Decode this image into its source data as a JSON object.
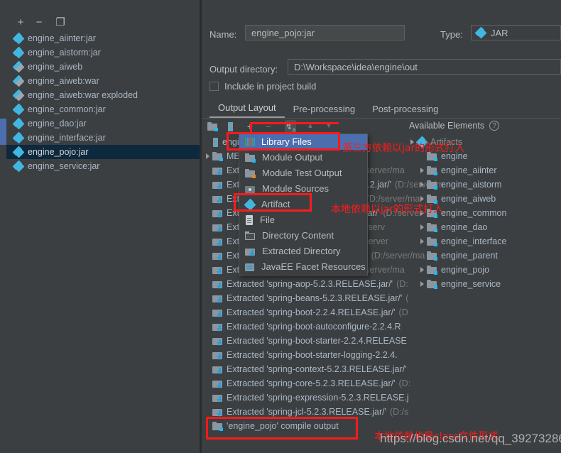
{
  "left_panel": {
    "toolbar": [
      {
        "name": "add",
        "glyph": "+"
      },
      {
        "name": "remove",
        "glyph": "−"
      },
      {
        "name": "copy",
        "glyph": "❐"
      }
    ],
    "items": [
      {
        "label": "engine_aiinter:jar",
        "icon": "jar-icon",
        "selected": false
      },
      {
        "label": "engine_aistorm:jar",
        "icon": "jar-icon",
        "selected": false
      },
      {
        "label": "engine_aiweb",
        "icon": "war-icon",
        "selected": false
      },
      {
        "label": "engine_aiweb:war",
        "icon": "war-icon",
        "selected": false
      },
      {
        "label": "engine_aiweb:war exploded",
        "icon": "war-icon",
        "selected": false
      },
      {
        "label": "engine_common:jar",
        "icon": "jar-icon",
        "selected": false
      },
      {
        "label": "engine_dao:jar",
        "icon": "jar-icon",
        "selected": false
      },
      {
        "label": "engine_interface:jar",
        "icon": "jar-icon",
        "selected": false
      },
      {
        "label": "engine_pojo:jar",
        "icon": "jar-icon",
        "selected": true
      },
      {
        "label": "engine_service:jar",
        "icon": "jar-icon",
        "selected": false
      }
    ]
  },
  "form": {
    "name_label": "Name:",
    "name_value": "engine_pojo:jar",
    "type_label": "Type:",
    "type_value": "JAR",
    "output_dir_label": "Output directory:",
    "output_dir_value": "D:\\Workspace\\idea\\engine\\out",
    "include_checkbox_label": "Include in project build",
    "include_checked": false
  },
  "tabs": [
    {
      "label": "Output Layout",
      "active": true
    },
    {
      "label": "Pre-processing",
      "active": false
    },
    {
      "label": "Post-processing",
      "active": false
    }
  ],
  "layout_toolbar": [
    {
      "name": "create-directory",
      "glyph": "▤"
    },
    {
      "name": "create-archive",
      "glyph": "‖"
    },
    {
      "name": "add-element",
      "glyph": "+"
    },
    {
      "name": "remove-element",
      "glyph": "−"
    },
    {
      "name": "sort-az",
      "glyph": "↧"
    },
    {
      "name": "move-up",
      "glyph": "▲"
    },
    {
      "name": "move-down",
      "glyph": "▼"
    }
  ],
  "available_elements": {
    "title": "Available Elements",
    "help_glyph": "?",
    "root": "Artifacts",
    "items": [
      {
        "label": "engine",
        "expandable": false
      },
      {
        "label": "engine_aiinter",
        "expandable": true
      },
      {
        "label": "engine_aistorm",
        "expandable": true
      },
      {
        "label": "engine_aiweb",
        "expandable": true
      },
      {
        "label": "engine_common",
        "expandable": true
      },
      {
        "label": "engine_dao",
        "expandable": true
      },
      {
        "label": "engine_interface",
        "expandable": true
      },
      {
        "label": "engine_parent",
        "expandable": false
      },
      {
        "label": "engine_pojo",
        "expandable": true
      },
      {
        "label": "engine_service",
        "expandable": true
      }
    ]
  },
  "output_tree": {
    "rows": [
      {
        "label": "engine_pojo.jar",
        "icon": "archive-icon",
        "hint": "",
        "arrow": false,
        "indent": 0
      },
      {
        "label": "META-INF",
        "icon": "folder-icon",
        "hint": "",
        "arrow": true,
        "indent": 0
      },
      {
        "label": "Extracted 'classmate-1.3.5.jar/'",
        "icon": "extracted-icon",
        "hint": "(D:/server/ma",
        "arrow": true,
        "indent": 0
      },
      {
        "label": "Extracted 'jackson-annotations-2.10.2.jar/'",
        "icon": "extracted-icon",
        "hint": "(D:/server/m",
        "arrow": true,
        "indent": 0
      },
      {
        "label": "Extracted 'jackson-core-2.10.2.jar/'",
        "icon": "extracted-icon",
        "hint": "(D:/server/ma",
        "arrow": true,
        "indent": 0
      },
      {
        "label": "Extracted 'jackson-databind-2.10.2.jar/'",
        "icon": "extracted-icon",
        "hint": "(D:/server",
        "arrow": true,
        "indent": 0
      },
      {
        "label": "Extracted 'jul-to-slf4j-1.7.30.jar/'",
        "icon": "extracted-icon",
        "hint": "(D:/serv",
        "arrow": true,
        "indent": 0
      },
      {
        "label": "Extracted 'log4j-api-2.12.1.jar/'",
        "icon": "extracted-icon",
        "hint": "(D:/server",
        "arrow": true,
        "indent": 0
      },
      {
        "label": "Extracted 'logback-classic-1.2.3.jar/'",
        "icon": "extracted-icon",
        "hint": "(D:/server/ma",
        "arrow": false,
        "indent": 0
      },
      {
        "label": "Extracted 'snakeyaml-1.25.jar/'",
        "icon": "extracted-icon",
        "hint": "(D:/server/ma",
        "arrow": true,
        "indent": 0
      },
      {
        "label": "Extracted 'spring-aop-5.2.3.RELEASE.jar/'",
        "icon": "extracted-icon",
        "hint": "(D:",
        "arrow": true,
        "indent": 0
      },
      {
        "label": "Extracted 'spring-beans-5.2.3.RELEASE.jar/'",
        "icon": "extracted-icon",
        "hint": "(",
        "arrow": false,
        "indent": 0
      },
      {
        "label": "Extracted 'spring-boot-2.2.4.RELEASE.jar/'",
        "icon": "extracted-icon",
        "hint": "(D",
        "arrow": false,
        "indent": 0
      },
      {
        "label": "Extracted 'spring-boot-autoconfigure-2.2.4.R",
        "icon": "extracted-icon",
        "hint": "",
        "arrow": false,
        "indent": 0
      },
      {
        "label": "Extracted 'spring-boot-starter-2.2.4.RELEASE",
        "icon": "extracted-icon",
        "hint": "",
        "arrow": false,
        "indent": 0
      },
      {
        "label": "Extracted 'spring-boot-starter-logging-2.2.4.",
        "icon": "extracted-icon",
        "hint": "",
        "arrow": false,
        "indent": 0
      },
      {
        "label": "Extracted 'spring-context-5.2.3.RELEASE.jar/'",
        "icon": "extracted-icon",
        "hint": "",
        "arrow": false,
        "indent": 0
      },
      {
        "label": "Extracted 'spring-core-5.2.3.RELEASE.jar/'",
        "icon": "extracted-icon",
        "hint": "(D:",
        "arrow": false,
        "indent": 0
      },
      {
        "label": "Extracted 'spring-expression-5.2.3.RELEASE.j",
        "icon": "extracted-icon",
        "hint": "",
        "arrow": false,
        "indent": 0
      },
      {
        "label": "Extracted 'spring-jcl-5.2.3.RELEASE.jar/'",
        "icon": "extracted-icon",
        "hint": "(D:/s",
        "arrow": false,
        "indent": 0
      },
      {
        "label": "'engine_pojo' compile output",
        "icon": "folder-icon",
        "hint": "",
        "arrow": false,
        "indent": 0
      }
    ]
  },
  "popup_menu": {
    "items": [
      {
        "label": "Library Files",
        "icon": "library-files-icon",
        "highlighted": true
      },
      {
        "label": "Module Output",
        "icon": "module-output-icon",
        "highlighted": false
      },
      {
        "label": "Module Test Output",
        "icon": "module-test-output-icon",
        "highlighted": false
      },
      {
        "label": "Module Sources",
        "icon": "module-sources-icon",
        "highlighted": false
      },
      {
        "label": "Artifact",
        "icon": "artifact-icon",
        "highlighted": false
      },
      {
        "label": "File",
        "icon": "file-icon",
        "highlighted": false
      },
      {
        "label": "Directory Content",
        "icon": "directory-content-icon",
        "highlighted": false
      },
      {
        "label": "Extracted Directory",
        "icon": "extracted-directory-icon",
        "highlighted": false
      },
      {
        "label": "JavaEE Facet Resources",
        "icon": "javaee-facet-icon",
        "highlighted": false
      }
    ]
  },
  "annotations": {
    "note_third_party": "第三方依赖以jar的形式打入",
    "note_local_jar": "本地依赖以jar的形式打入",
    "note_local_class": "本地依赖也是class文件形式",
    "accent_color": "#ff1a1a"
  },
  "watermark": "https://blog.csdn.net/qq_39273286"
}
